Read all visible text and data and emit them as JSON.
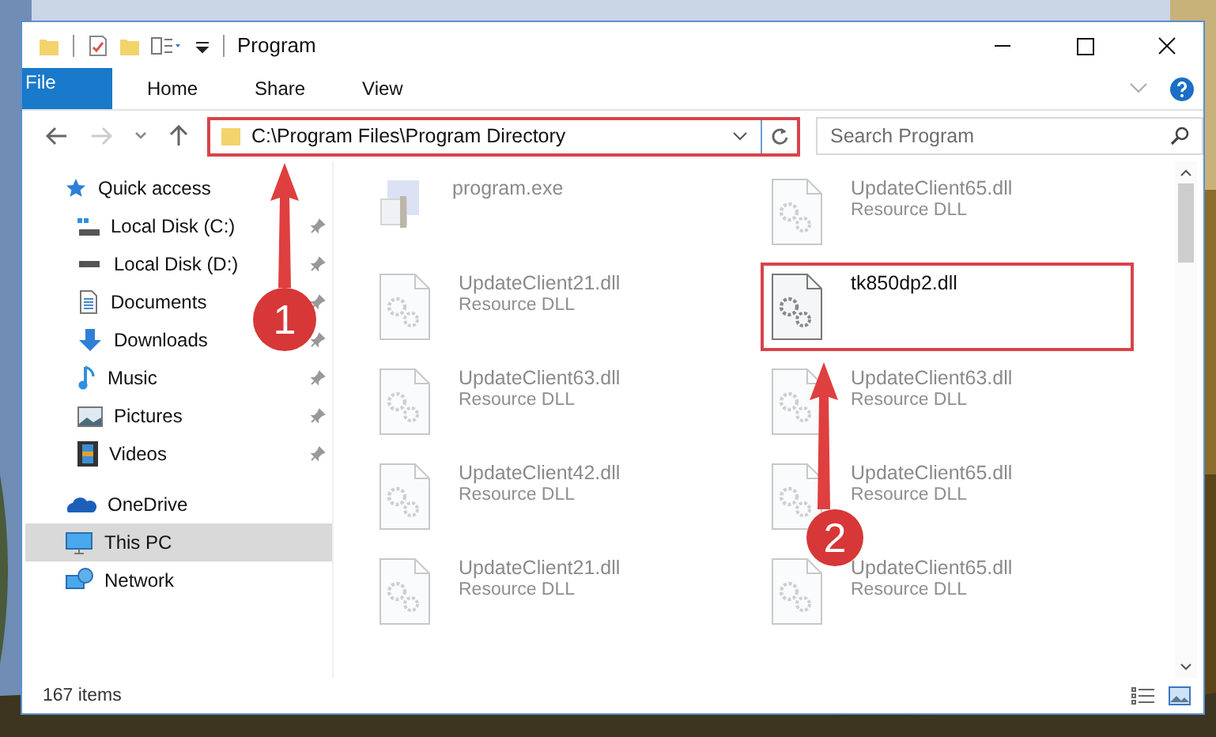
{
  "window": {
    "title": "Program"
  },
  "ribbon": {
    "tabs": [
      {
        "label": "File",
        "kind": "menu"
      },
      {
        "label": "Home",
        "kind": "tab",
        "selected": false
      },
      {
        "label": "Share",
        "kind": "tab",
        "selected": false
      },
      {
        "label": "View",
        "kind": "tab",
        "selected": false
      }
    ]
  },
  "address_bar": {
    "path": "C:\\Program Files\\Program Directory",
    "highlighted": true
  },
  "search": {
    "placeholder": "Search Program"
  },
  "sidebar": {
    "items": [
      {
        "label": "Quick access",
        "kind": "star",
        "selected": false,
        "children": [
          {
            "label": "Local Disk (C:)",
            "kind": "system-drive",
            "pinned": true,
            "selected": false
          },
          {
            "label": "Local Disk (D:)",
            "kind": "drive",
            "pinned": true,
            "selected": false
          },
          {
            "label": "Documents",
            "kind": "documents",
            "pinned": true,
            "selected": false
          },
          {
            "label": "Downloads",
            "kind": "downloads",
            "pinned": true,
            "selected": false
          },
          {
            "label": "Music",
            "kind": "music",
            "pinned": true,
            "selected": false
          },
          {
            "label": "Pictures",
            "kind": "pictures",
            "pinned": true,
            "selected": false
          },
          {
            "label": "Videos",
            "kind": "videos",
            "pinned": true,
            "selected": false
          }
        ]
      },
      {
        "label": "OneDrive",
        "kind": "cloud",
        "selected": false
      },
      {
        "label": "This PC",
        "kind": "pc",
        "selected": true
      },
      {
        "label": "Network",
        "kind": "network",
        "selected": false
      }
    ]
  },
  "files": [
    {
      "name": "program.exe",
      "kind": "exe",
      "dimmed": true,
      "highlighted": false
    },
    {
      "name": "UpdateClient65.dll",
      "type": "Resource DLL",
      "kind": "dll",
      "dimmed": true,
      "highlighted": false
    },
    {
      "name": "UpdateClient21.dll",
      "type": "Resource DLL",
      "kind": "dll",
      "dimmed": true,
      "highlighted": false
    },
    {
      "name": "tk850dp2.dll",
      "kind": "dll",
      "dimmed": false,
      "highlighted": true
    },
    {
      "name": "UpdateClient63.dll",
      "type": "Resource DLL",
      "kind": "dll",
      "dimmed": true,
      "highlighted": false
    },
    {
      "name": "UpdateClient63.dll",
      "type": "Resource DLL",
      "kind": "dll",
      "dimmed": true,
      "highlighted": false
    },
    {
      "name": "UpdateClient42.dll",
      "type": "Resource DLL",
      "kind": "dll",
      "dimmed": true,
      "highlighted": false
    },
    {
      "name": "UpdateClient65.dll",
      "type": "Resource DLL",
      "kind": "dll",
      "dimmed": true,
      "highlighted": false
    },
    {
      "name": "UpdateClient21.dll",
      "type": "Resource DLL",
      "kind": "dll",
      "dimmed": true,
      "highlighted": false
    },
    {
      "name": "UpdateClient65.dll",
      "type": "Resource DLL",
      "kind": "dll",
      "dimmed": true,
      "highlighted": false
    }
  ],
  "status_bar": {
    "count": "167 items"
  },
  "callouts": [
    {
      "number": "1"
    },
    {
      "number": "2"
    }
  ]
}
